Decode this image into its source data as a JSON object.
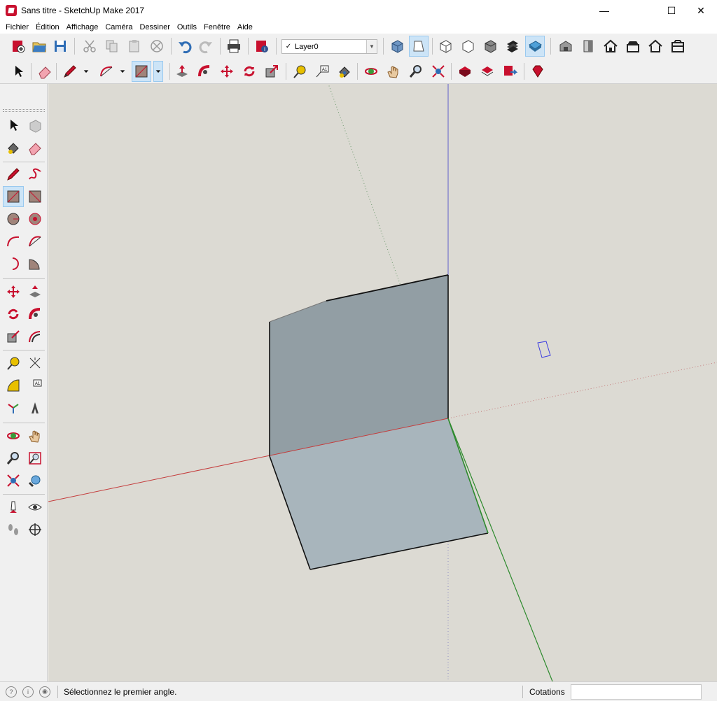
{
  "window": {
    "title": "Sans titre - SketchUp Make 2017",
    "minimize": "—",
    "maximize": "☐",
    "close": "✕"
  },
  "menu": [
    "Fichier",
    "Édition",
    "Affichage",
    "Caméra",
    "Dessiner",
    "Outils",
    "Fenêtre",
    "Aide"
  ],
  "layer": {
    "check": "✓",
    "current": "Layer0",
    "dropdown": "▼"
  },
  "status": {
    "message": "Sélectionnez le premier angle.",
    "measurements_label": "Cotations",
    "measurements_value": ""
  },
  "colors": {
    "viewport_bg": "#dcdad3",
    "face_front": "#929ea4",
    "face_back": "#a8b5bc",
    "axis_red": "#c43c3c",
    "axis_green": "#2d8a2d",
    "axis_blue": "#4040c0",
    "active_tool": "#cce4f7",
    "sketchup_red": "#c8102e"
  },
  "icons": {
    "toolbar_row1": [
      "new-file-icon",
      "open-file-icon",
      "save-icon",
      "cut-icon",
      "copy-icon",
      "paste-icon",
      "erase-delete-icon",
      "undo-icon",
      "redo-icon",
      "print-icon",
      "model-info-icon",
      "iso-view-icon",
      "top-view-icon",
      "front-view-icon",
      "right-view-icon",
      "back-view-icon",
      "left-view-icon",
      "xray-icon",
      "wireframe-icon",
      "hidden-line-icon",
      "shaded-icon",
      "shaded-textures-icon",
      "monochrome-icon",
      "warehouse-icon",
      "component-icon",
      "house-icon",
      "house-top-icon",
      "house-outline-icon",
      "house-open-icon"
    ],
    "toolbar_row2": [
      "select-icon",
      "eraser-icon",
      "pencil-icon",
      "arc-icon",
      "rectangle-icon",
      "push-pull-icon",
      "follow-me-icon",
      "move-icon",
      "rotate-icon",
      "scale-icon",
      "tape-measure-icon",
      "text-icon",
      "paint-bucket-icon",
      "orbit-icon",
      "pan-icon",
      "zoom-icon",
      "zoom-extents-icon",
      "warehouse-get-icon",
      "share-model-icon",
      "extension-warehouse-icon",
      "ruby-icon"
    ]
  }
}
